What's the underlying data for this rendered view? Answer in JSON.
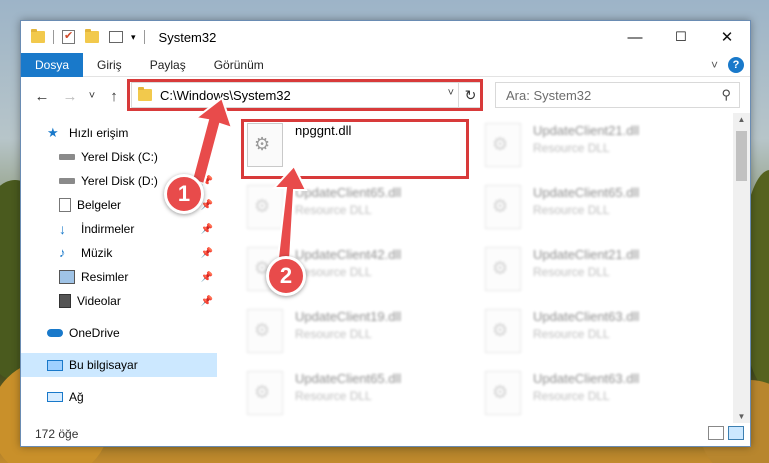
{
  "window": {
    "title": "System32",
    "minimize": "—",
    "maximize": "☐",
    "close": "✕"
  },
  "ribbon": {
    "tabs": [
      "Dosya",
      "Giriş",
      "Paylaş",
      "Görünüm"
    ],
    "expand_icon": "chevron-down-icon",
    "help": "?"
  },
  "nav": {
    "back": "←",
    "forward": "→",
    "recent": "˅",
    "up": "↑",
    "address": "C:\\Windows\\System32",
    "address_dropdown": "˅",
    "refresh": "↻",
    "search_placeholder": "Ara: System32",
    "search_icon": "⚲"
  },
  "sidebar": {
    "items": [
      {
        "label": "Hızlı erişim",
        "icon": "star-icon",
        "pinned": false
      },
      {
        "label": "Yerel Disk (C:)",
        "icon": "drive-icon",
        "pinned": true
      },
      {
        "label": "Yerel Disk (D:)",
        "icon": "drive-icon",
        "pinned": true
      },
      {
        "label": "Belgeler",
        "icon": "documents-icon",
        "pinned": true
      },
      {
        "label": "İndirmeler",
        "icon": "download-icon",
        "pinned": true
      },
      {
        "label": "Müzik",
        "icon": "music-icon",
        "pinned": true
      },
      {
        "label": "Resimler",
        "icon": "pictures-icon",
        "pinned": true
      },
      {
        "label": "Videolar",
        "icon": "video-icon",
        "pinned": true
      },
      {
        "label": "OneDrive",
        "icon": "cloud-icon",
        "pinned": false
      },
      {
        "label": "Bu bilgisayar",
        "icon": "computer-icon",
        "pinned": false
      },
      {
        "label": "Ağ",
        "icon": "network-icon",
        "pinned": false
      }
    ]
  },
  "files": {
    "col1": [
      {
        "name": "npggnt.dll",
        "type": ""
      },
      {
        "name": "UpdateClient65.dll",
        "type": "Resource DLL"
      },
      {
        "name": "UpdateClient42.dll",
        "type": "Resource DLL"
      },
      {
        "name": "UpdateClient19.dll",
        "type": "Resource DLL"
      },
      {
        "name": "UpdateClient65.dll",
        "type": "Resource DLL"
      }
    ],
    "col2": [
      {
        "name": "UpdateClient21.dll",
        "type": "Resource DLL"
      },
      {
        "name": "UpdateClient65.dll",
        "type": "Resource DLL"
      },
      {
        "name": "UpdateClient21.dll",
        "type": "Resource DLL"
      },
      {
        "name": "UpdateClient63.dll",
        "type": "Resource DLL"
      },
      {
        "name": "UpdateClient63.dll",
        "type": "Resource DLL"
      }
    ]
  },
  "status": {
    "count": "172 öğe"
  },
  "callouts": [
    "1",
    "2"
  ],
  "colors": {
    "accent": "#1979ca",
    "highlight": "#d83a3a",
    "callout": "#e84b4b"
  }
}
